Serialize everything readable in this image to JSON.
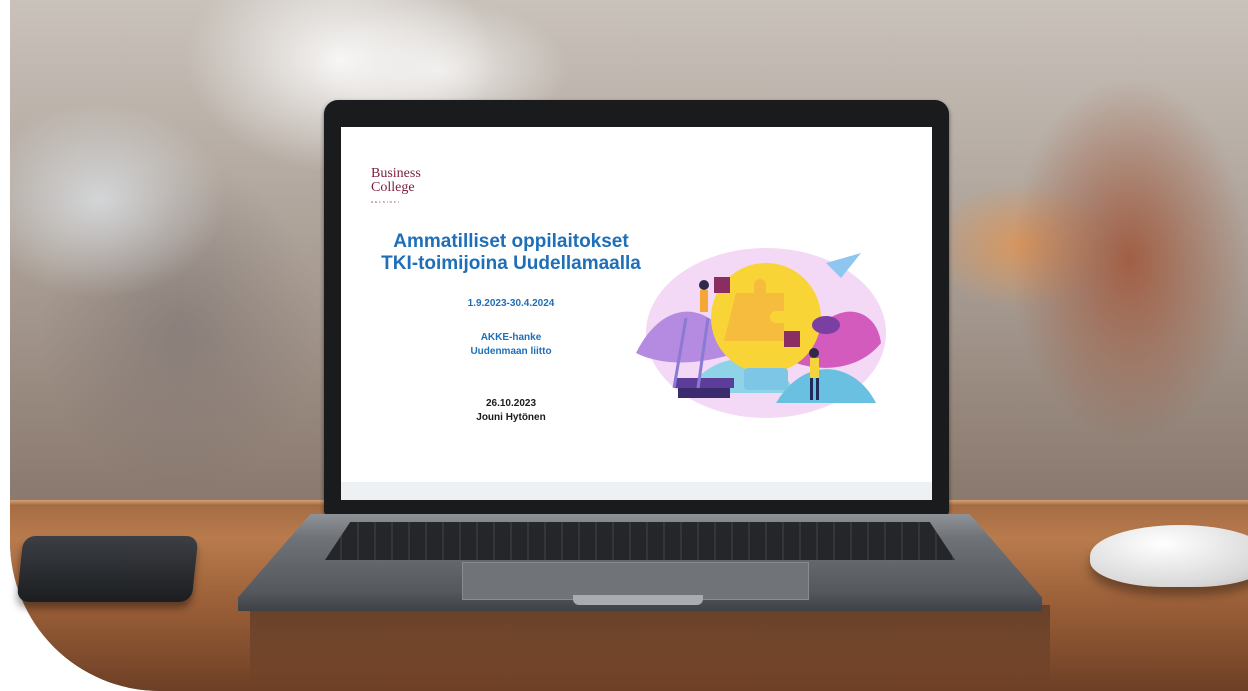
{
  "slide": {
    "logo_line1": "Business",
    "logo_line2": "College",
    "logo_sub": "HELSINKI",
    "title_line1": "Ammatilliset oppilaitokset",
    "title_line2": "TKI-toimijoina Uudellamaalla",
    "period": "1.9.2023-30.4.2024",
    "project": "AKKE-hanke",
    "organization": "Uudenmaan liitto",
    "date": "26.10.2023",
    "author": "Jouni Hytönen"
  },
  "colors": {
    "title_blue": "#1f6fb8",
    "logo_maroon": "#7a1f3a",
    "table_wood": "#a26a42"
  },
  "icons": [
    "lightbulb-puzzle-illustration",
    "paper-plane-icon",
    "speech-bubble-icon"
  ]
}
